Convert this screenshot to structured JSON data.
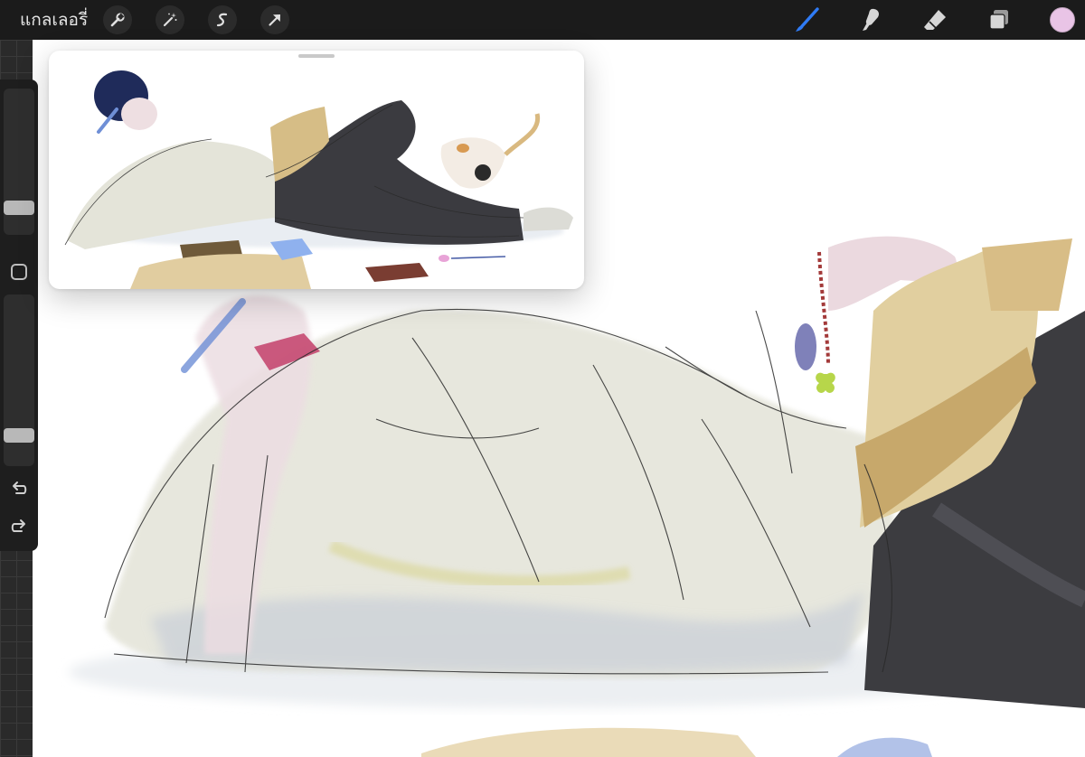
{
  "topbar": {
    "gallery_label": "แกลเลอรี่",
    "left_tools": [
      "wrench-icon",
      "magic-wand-icon",
      "selection-icon",
      "transform-arrow-icon"
    ],
    "right_tools": [
      "brush-icon",
      "smudge-icon",
      "eraser-icon",
      "layers-icon"
    ],
    "active_tool": "brush-icon",
    "active_tool_color": "#2f7bf5",
    "current_color": "#e9c4e6"
  },
  "sidebar": {
    "brush_size": 0.15,
    "opacity": 0.15,
    "controls": [
      "modify-button",
      "undo-icon",
      "redo-icon"
    ]
  },
  "reference_window": {
    "visible": true
  },
  "colors": {
    "toolbar_bg": "#1b1b1b",
    "sweater": "#e6e6dc",
    "pants": "#3c3c40",
    "book": "#d9c08a",
    "hair": "#1f2b5a"
  }
}
